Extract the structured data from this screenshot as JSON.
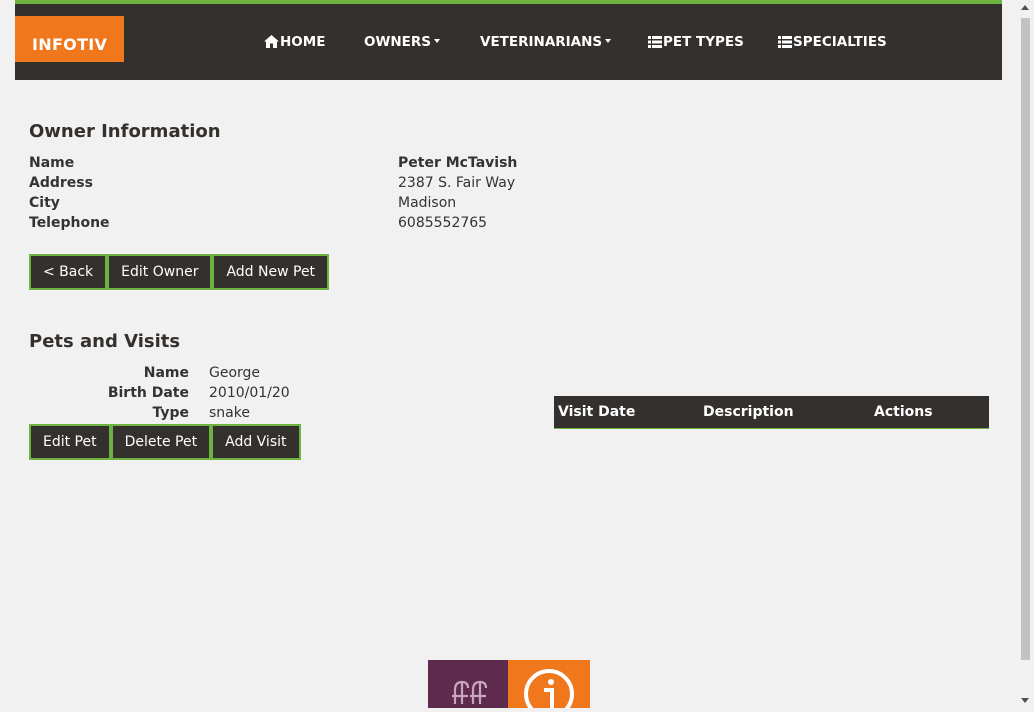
{
  "brand": "INFOTIV",
  "nav": {
    "home": "HOME",
    "owners": "OWNERS",
    "veterinarians": "VETERINARIANS",
    "pet_types": "PET TYPES",
    "specialties": "SPECIALTIES"
  },
  "owner": {
    "heading": "Owner Information",
    "name_label": "Name",
    "address_label": "Address",
    "city_label": "City",
    "telephone_label": "Telephone",
    "name": "Peter McTavish",
    "address": "2387 S. Fair Way",
    "city": "Madison",
    "telephone": "6085552765",
    "buttons": {
      "back": "< Back",
      "edit": "Edit Owner",
      "add_pet": "Add New Pet"
    }
  },
  "pets": {
    "heading": "Pets and Visits",
    "name_label": "Name",
    "birth_date_label": "Birth Date",
    "type_label": "Type",
    "name": "George",
    "birth_date": "2010/01/20",
    "type": "snake",
    "buttons": {
      "edit": "Edit Pet",
      "delete": "Delete Pet",
      "add_visit": "Add Visit"
    },
    "visits_table": {
      "columns": [
        "Visit Date",
        "Description",
        "Actions"
      ]
    }
  },
  "colors": {
    "nav_bg": "#34302d",
    "accent_green": "#6db33f",
    "brand_orange": "#f1771c",
    "footer_purple": "#5e2b4f"
  },
  "icons": {
    "home": "home-icon",
    "list": "list-icon",
    "caret": "caret-down-icon"
  }
}
